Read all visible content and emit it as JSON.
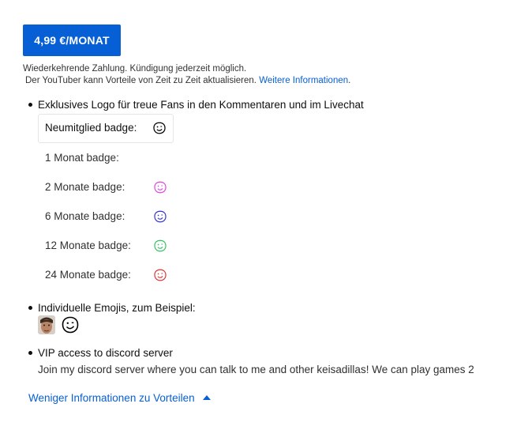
{
  "membership": {
    "price_button": "4,99 €/MONAT",
    "note_line1": "Wiederkehrende Zahlung. Kündigung jederzeit möglich.",
    "note_line2": "Der YouTuber kann Vorteile von Zeit zu Zeit aktualisieren.",
    "more_info_link": "Weitere Informationen",
    "note_period": "."
  },
  "perks": [
    {
      "title": "Exklusives Logo für treue Fans in den Kommentaren und im Livechat",
      "badges": [
        {
          "label": "Neumitglied badge:",
          "icon": "smiley-badge-black",
          "color": "#000000"
        },
        {
          "label": "1 Monat badge:",
          "icon": "none",
          "color": ""
        },
        {
          "label": "2 Monate badge:",
          "icon": "smiley-badge-magenta",
          "color": "#e040e0"
        },
        {
          "label": "6 Monate badge:",
          "icon": "smiley-badge-blue",
          "color": "#3030d0"
        },
        {
          "label": "12 Monate badge:",
          "icon": "smiley-badge-green",
          "color": "#30c060"
        },
        {
          "label": "24 Monate badge:",
          "icon": "smiley-badge-red",
          "color": "#e03030"
        }
      ]
    },
    {
      "title": "Individuelle Emojis, zum Beispiel:",
      "emojis": [
        "face-photo-emoji",
        "smiley-emoji"
      ]
    },
    {
      "title": "VIP access to discord server",
      "description": "Join my discord server where you can talk to me and other keisadillas! We can play games 2"
    }
  ],
  "toggle": {
    "label": "Weniger Informationen zu Vorteilen",
    "icon": "caret-up-icon"
  },
  "colors": {
    "accent": "#065fd4",
    "text": "#0f0f0f",
    "secondary_text": "#303030"
  }
}
